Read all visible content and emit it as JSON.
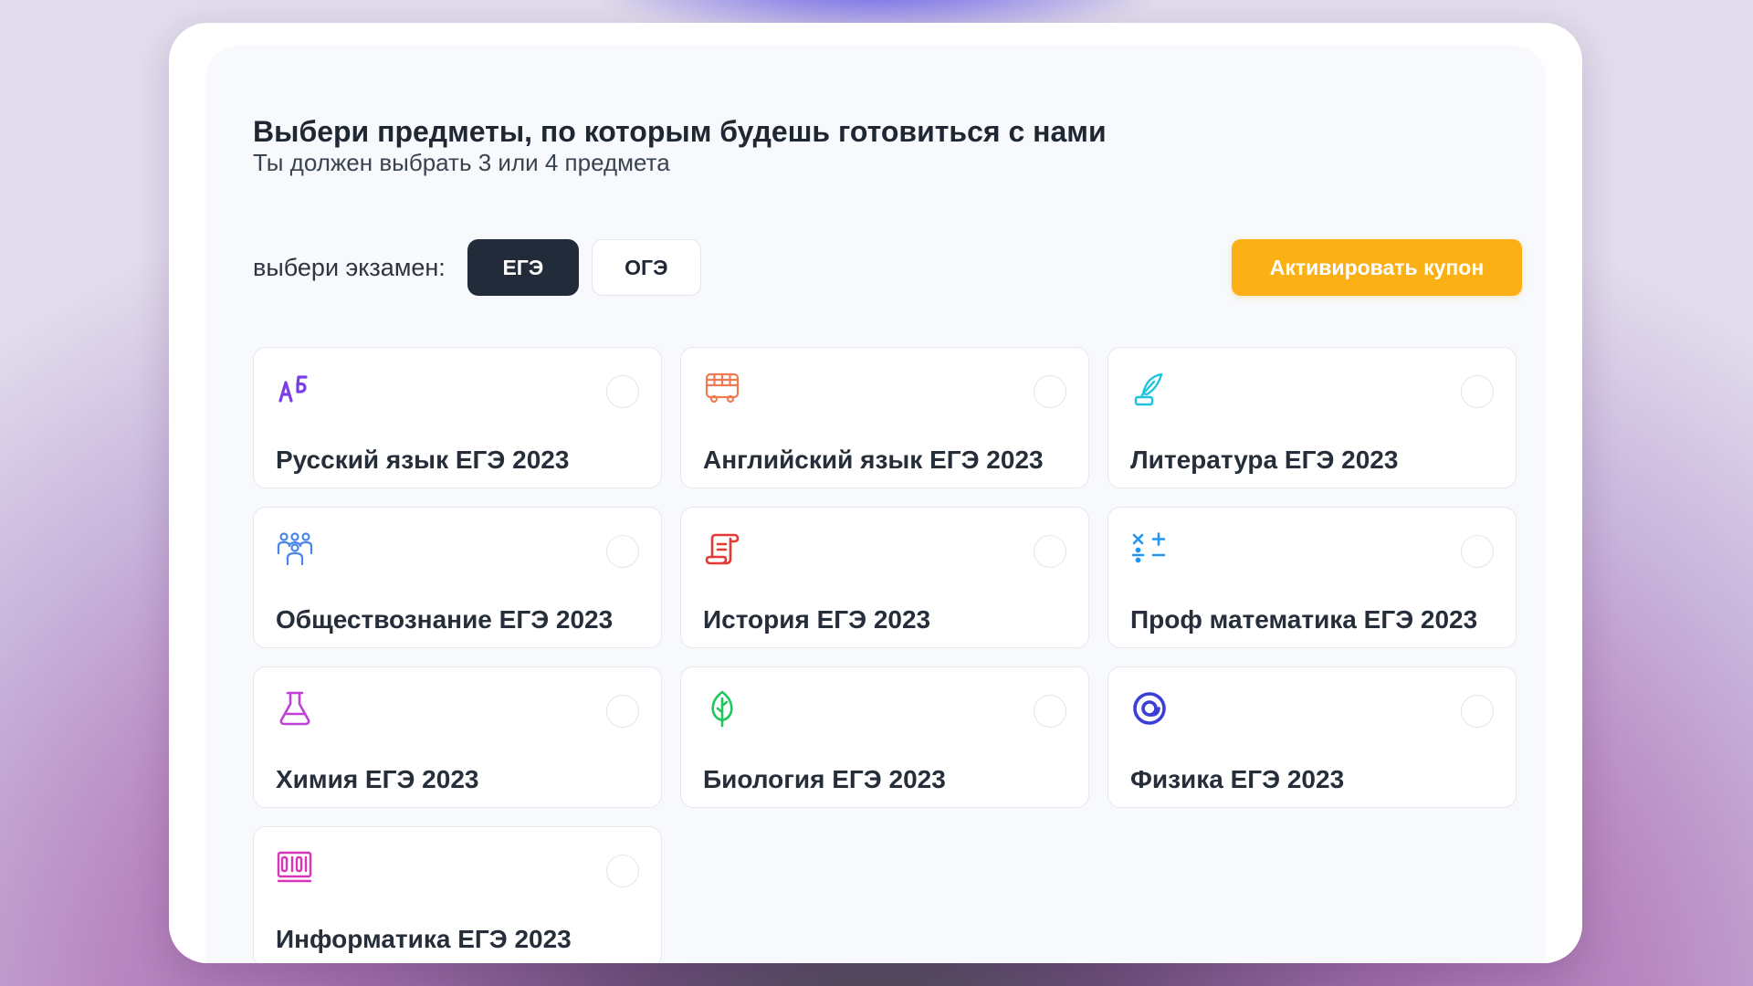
{
  "heading": {
    "title": "Выбери предметы, по которым будешь готовиться с нами",
    "subtitle": "Ты должен выбрать 3 или 4 предмета"
  },
  "exam_selector": {
    "label": "выбери экзамен:",
    "options": [
      "ЕГЭ",
      "ОГЭ"
    ],
    "selected": "ЕГЭ"
  },
  "coupon_button": {
    "label": "Активировать купон",
    "color": "#fbb115"
  },
  "subjects": [
    {
      "label": "Русский язык ЕГЭ 2023",
      "icon": "alphabet-icon",
      "color": "#7b3fe4"
    },
    {
      "label": "Английский язык ЕГЭ 2023",
      "icon": "bus-icon",
      "color": "#f07a52"
    },
    {
      "label": "Литература ЕГЭ 2023",
      "icon": "quill-icon",
      "color": "#1ec3e0"
    },
    {
      "label": "Обществознание ЕГЭ 2023",
      "icon": "people-icon",
      "color": "#4a86e8"
    },
    {
      "label": "История ЕГЭ 2023",
      "icon": "scroll-icon",
      "color": "#e53935"
    },
    {
      "label": "Проф математика ЕГЭ 2023",
      "icon": "math-operators-icon",
      "color": "#2196f3"
    },
    {
      "label": "Химия ЕГЭ 2023",
      "icon": "flask-icon",
      "color": "#c040d8"
    },
    {
      "label": "Биология ЕГЭ 2023",
      "icon": "leaf-icon",
      "color": "#22c55e"
    },
    {
      "label": "Физика ЕГЭ 2023",
      "icon": "atom-icon",
      "color": "#3b3fd8"
    },
    {
      "label": "Информатика ЕГЭ 2023",
      "icon": "binary-screen-icon",
      "color": "#d935b8"
    }
  ]
}
